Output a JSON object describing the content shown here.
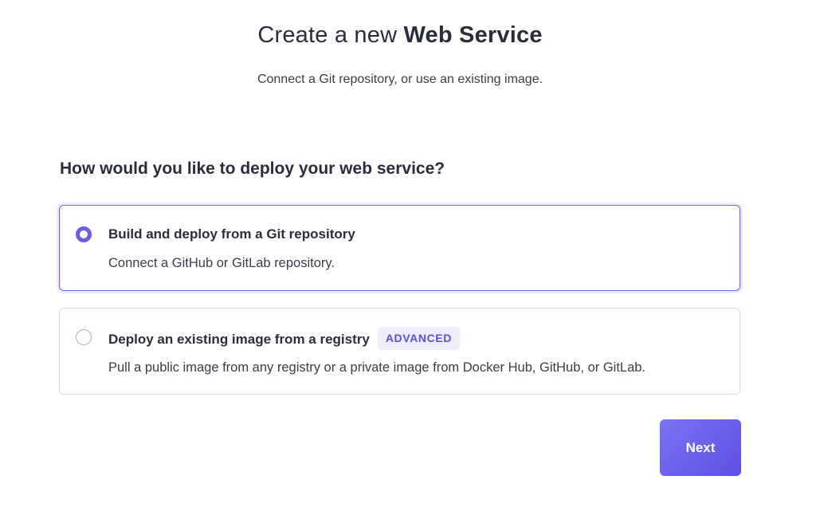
{
  "header": {
    "title_prefix": "Create a new ",
    "title_bold": "Web Service",
    "subtitle": "Connect a Git repository, or use an existing image."
  },
  "form": {
    "question": "How would you like to deploy your web service?",
    "options": [
      {
        "title": "Build and deploy from a Git repository",
        "description": "Connect a GitHub or GitLab repository.",
        "selected": true
      },
      {
        "title": "Deploy an existing image from a registry",
        "badge": "ADVANCED",
        "description": "Pull a public image from any registry or a private image from Docker Hub, GitHub, or GitLab.",
        "selected": false
      }
    ]
  },
  "actions": {
    "next_label": "Next"
  },
  "colors": {
    "accent": "#6b5ce7",
    "selected_border": "#6f64ee",
    "unselected_border": "#d7dbe6",
    "badge_bg": "#efedfd",
    "badge_text": "#5b4ee0",
    "text": "#2b2d3a"
  }
}
